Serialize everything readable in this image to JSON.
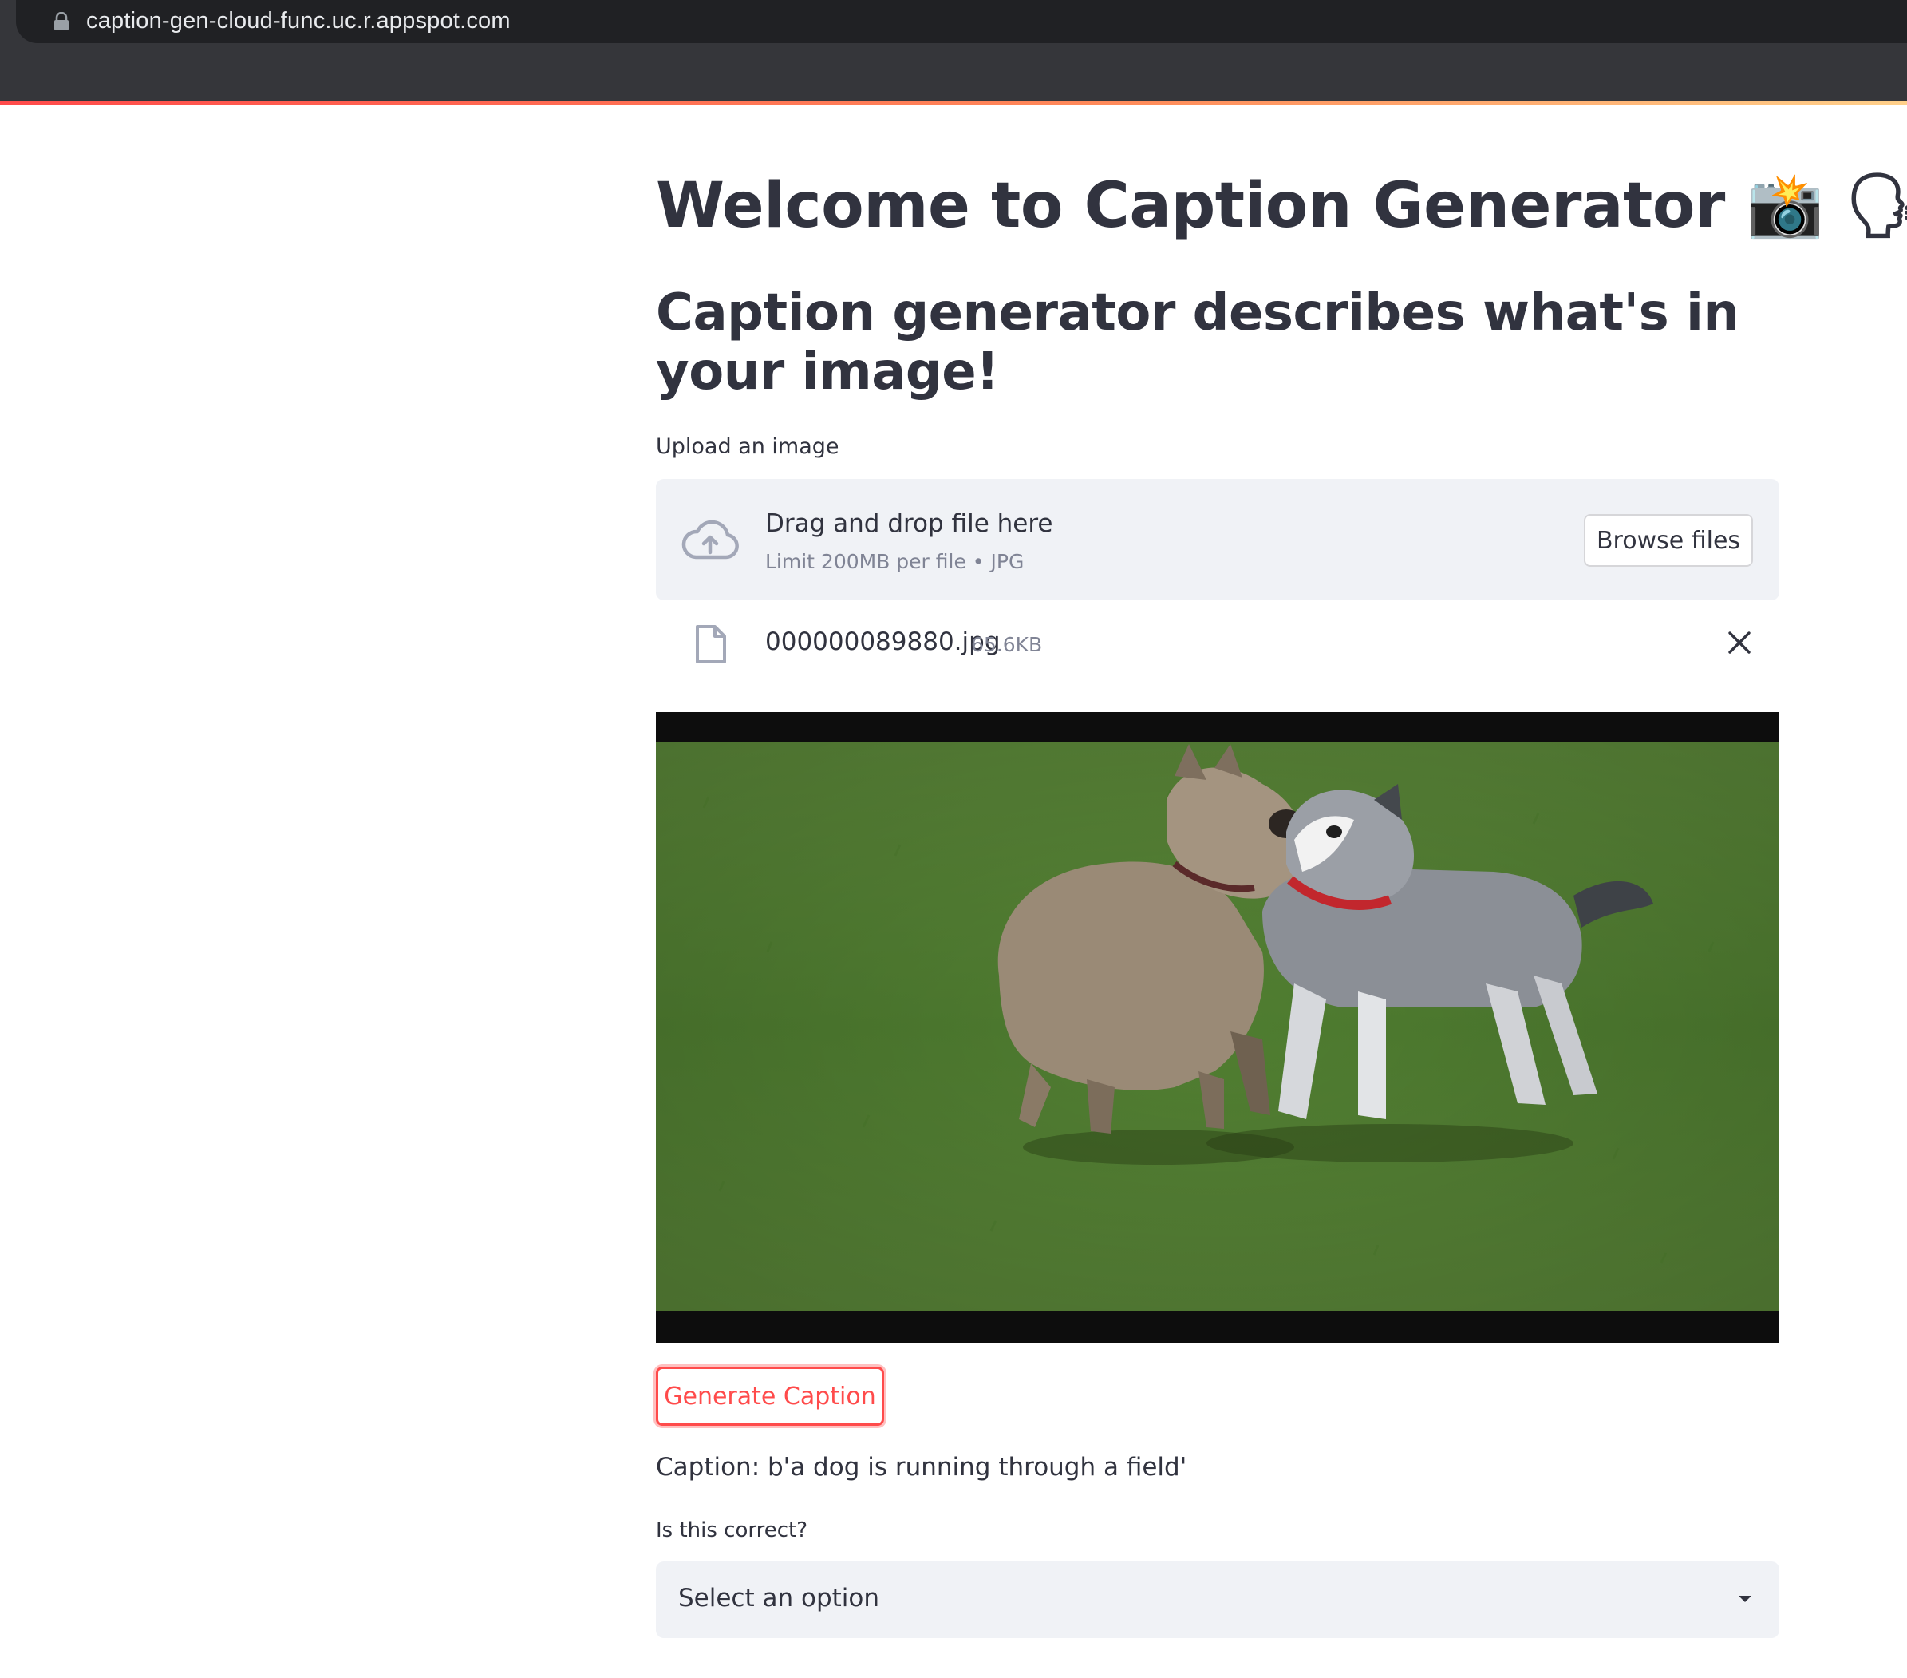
{
  "browser": {
    "url": "caption-gen-cloud-func.uc.r.appspot.com"
  },
  "page": {
    "title": "Welcome to Caption Generator 📸 🗣",
    "subtitle": "Caption generator describes what's in your image!"
  },
  "uploader": {
    "label": "Upload an image",
    "drop_text": "Drag and drop file here",
    "limit_text": "Limit 200MB per file • JPG",
    "browse_label": "Browse files"
  },
  "file": {
    "name": "000000089880.jpg",
    "size": "65.6KB"
  },
  "generate_button": "Generate Caption",
  "caption": "Caption: b'a dog is running through a field'",
  "feedback": {
    "label": "Is this correct?",
    "selected": "Select an option"
  },
  "colors": {
    "accent": "#ff4b4b",
    "text": "#31333f",
    "muted": "#808495",
    "panel": "#f0f2f6",
    "chrome": "#202124"
  },
  "icons": [
    "lock-icon",
    "cloud-upload-icon",
    "file-icon",
    "close-icon",
    "chevron-down-icon"
  ]
}
